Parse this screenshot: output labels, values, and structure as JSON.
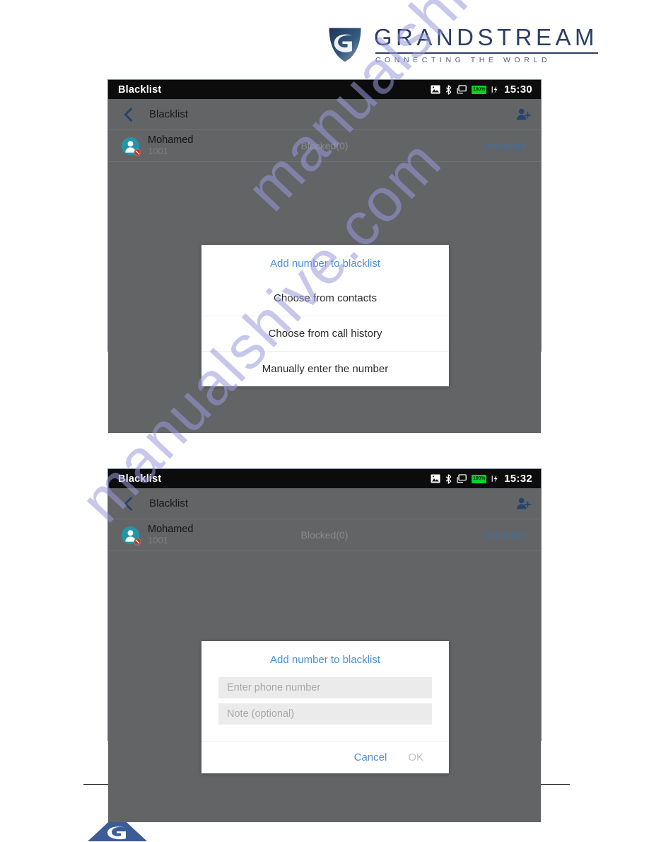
{
  "brand": {
    "name": "GRANDSTREAM",
    "tagline": "CONNECTING THE WORLD",
    "mark_color": "#2b4a7d",
    "text_color": "#2b3f66"
  },
  "watermark": {
    "text": "manualshive.com",
    "color": "#9a9ade"
  },
  "screens": [
    {
      "id": "screen-menu",
      "statusbar": {
        "title": "Blacklist",
        "time": "15:30",
        "battery_label": "100%",
        "icons": [
          "image-icon",
          "bluetooth-icon",
          "display-icon",
          "battery-icon",
          "charging-bolt-icon"
        ]
      },
      "navbar": {
        "back_icon": "chevron-left-icon",
        "title": "Blacklist",
        "action_icon": "add-contact-icon"
      },
      "contact": {
        "avatar_icon": "person-avatar-icon",
        "badge_icon": "blocked-badge-icon",
        "name": "Mohamed",
        "number": "1001",
        "blocked_count": "Blocked(0)",
        "status": "Unblocked",
        "status_color": "#3f6fa8"
      },
      "dialog": {
        "type": "menu",
        "title": "Add number to blacklist",
        "title_color": "#4a90d9",
        "items": [
          {
            "label": "Choose from contacts"
          },
          {
            "label": "Choose from call history"
          },
          {
            "label": "Manually enter the number"
          }
        ]
      }
    },
    {
      "id": "screen-form",
      "statusbar": {
        "title": "Blacklist",
        "time": "15:32",
        "battery_label": "100%",
        "icons": [
          "image-icon",
          "bluetooth-icon",
          "display-icon",
          "battery-icon",
          "charging-bolt-icon"
        ]
      },
      "navbar": {
        "back_icon": "chevron-left-icon",
        "title": "Blacklist",
        "action_icon": "add-contact-icon"
      },
      "contact": {
        "avatar_icon": "person-avatar-icon",
        "badge_icon": "blocked-badge-icon",
        "name": "Mohamed",
        "number": "1001",
        "blocked_count": "Blocked(0)",
        "status": "Unblocked",
        "status_color": "#3f6fa8"
      },
      "dialog": {
        "type": "form",
        "title": "Add number to blacklist",
        "title_color": "#4a90d9",
        "fields": [
          {
            "name": "phone",
            "value": "",
            "placeholder": "Enter phone number"
          },
          {
            "name": "note",
            "value": "",
            "placeholder": "Note (optional)"
          }
        ],
        "cancel_label": "Cancel",
        "ok_label": "OK",
        "cancel_color": "#4a90d9",
        "ok_color": "#c0c0c0"
      }
    }
  ],
  "colors": {
    "panel_background": "#636466",
    "statusbar_background": "#0c0c0c",
    "panel_border": "#6e86a4",
    "battery_green": "#00d427",
    "avatar_teal": "#2196a8",
    "accent_blue": "#4a90d9"
  }
}
